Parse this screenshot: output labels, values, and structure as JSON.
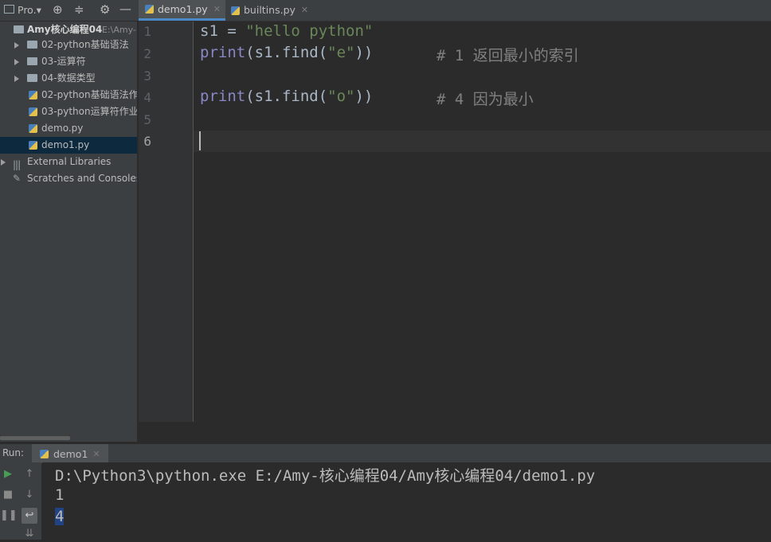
{
  "project_toolbar": {
    "title": "Pro.▾",
    "icons": [
      "globe-icon",
      "collapse-icon",
      "gear-icon",
      "minimize-icon"
    ]
  },
  "tabs": [
    {
      "label": "demo1.py",
      "active": true
    },
    {
      "label": "builtins.py",
      "active": false
    }
  ],
  "project_tree": {
    "root_name": "Amy核心编程04",
    "root_path": "E:\\Amy-",
    "items": [
      {
        "label": "02-python基础语法",
        "type": "folder"
      },
      {
        "label": "03-运算符",
        "type": "folder"
      },
      {
        "label": "04-数据类型",
        "type": "folder"
      },
      {
        "label": "02-python基础语法作",
        "type": "py"
      },
      {
        "label": "03-python运算符作业",
        "type": "py"
      },
      {
        "label": "demo.py",
        "type": "py"
      },
      {
        "label": "demo1.py",
        "type": "py",
        "selected": true
      }
    ],
    "external_libraries": "External Libraries",
    "scratches": "Scratches and Consoles"
  },
  "editor": {
    "line_numbers": [
      "1",
      "2",
      "3",
      "4",
      "5",
      "6"
    ],
    "current_line": "6",
    "lines": {
      "l1_var": "s1 = ",
      "l1_str": "\"hello python\"",
      "l2_kw": "print",
      "l2_code": "(s1.find(",
      "l2_str": "\"e\"",
      "l2_close": "))",
      "l2_cmt": "# 1 返回最小的索引",
      "l4_kw": "print",
      "l4_code": "(s1.find(",
      "l4_str": "\"o\"",
      "l4_close": "))",
      "l4_cmt": "# 4 因为最小"
    }
  },
  "run_panel": {
    "label": "Run:",
    "tab": "demo1",
    "output": [
      "D:\\Python3\\python.exe E:/Amy-核心编程04/Amy核心编程04/demo1.py",
      "1",
      "4"
    ]
  }
}
